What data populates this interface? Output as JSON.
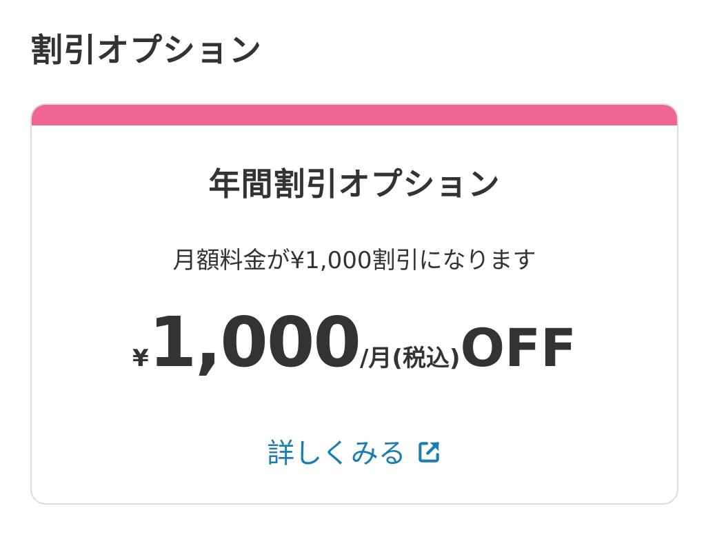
{
  "section": {
    "title": "割引オプション"
  },
  "card": {
    "accent_color": "#ef6596",
    "title": "年間割引オプション",
    "description": "月額料金が¥1,000割引になります",
    "price": {
      "currency": "¥",
      "amount": "1,000",
      "unit": "/月(税込)",
      "suffix": "OFF"
    },
    "link": {
      "label": "詳しくみる",
      "color": "#1a7fae",
      "icon": "external-link-icon"
    }
  }
}
